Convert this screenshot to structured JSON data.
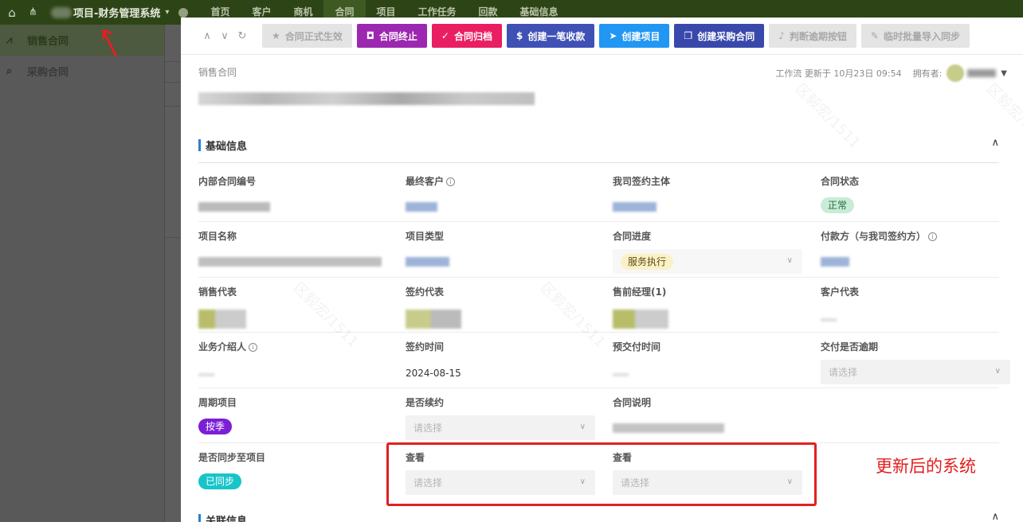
{
  "topnav": {
    "app_name": "项目-财务管理系统",
    "menu": [
      "首页",
      "客户",
      "商机",
      "合同",
      "项目",
      "工作任务",
      "回款",
      "基础信息"
    ],
    "active_menu": "合同"
  },
  "sidebar": {
    "items": [
      {
        "label": "销售合同",
        "active": true
      },
      {
        "label": "采购合同",
        "active": false
      }
    ]
  },
  "toolbar": {
    "buttons": [
      {
        "label": "合同正式生效",
        "style": "gray",
        "icon": "star-icon"
      },
      {
        "label": "合同终止",
        "style": "purple",
        "icon": "stop-icon"
      },
      {
        "label": "合同归档",
        "style": "pink",
        "icon": "check-icon"
      },
      {
        "label": "创建一笔收款",
        "style": "indigo",
        "icon": "dollar-icon"
      },
      {
        "label": "创建项目",
        "style": "blue",
        "icon": "send-icon"
      },
      {
        "label": "创建采购合同",
        "style": "indigo2",
        "icon": "copy-icon"
      },
      {
        "label": "判断逾期按钮",
        "style": "gray",
        "icon": "bell-icon"
      },
      {
        "label": "临时批量导入同步",
        "style": "gray",
        "icon": "wrench-icon"
      }
    ]
  },
  "record": {
    "breadcrumb": "销售合同",
    "workflow_text": "工作流 更新于 10月23日 09:54",
    "owner_label": "拥有者:"
  },
  "section_basic": {
    "title": "基础信息"
  },
  "fields": {
    "internal_no": {
      "label": "内部合同编号"
    },
    "final_customer": {
      "label": "最终客户"
    },
    "our_entity": {
      "label": "我司签约主体"
    },
    "contract_status": {
      "label": "合同状态",
      "value": "正常"
    },
    "project_name": {
      "label": "项目名称"
    },
    "project_type": {
      "label": "项目类型"
    },
    "contract_progress": {
      "label": "合同进度",
      "value": "服务执行"
    },
    "payer": {
      "label": "付款方（与我司签约方）"
    },
    "sales_rep": {
      "label": "销售代表"
    },
    "signing_rep": {
      "label": "签约代表"
    },
    "presales_mgr": {
      "label": "售前经理(1)"
    },
    "customer_rep": {
      "label": "客户代表"
    },
    "referrer": {
      "label": "业务介绍人"
    },
    "sign_date": {
      "label": "签约时间",
      "value": "2024-08-15"
    },
    "expected_delivery": {
      "label": "预交付时间"
    },
    "delivery_overdue": {
      "label": "交付是否逾期",
      "placeholder": "请选择"
    },
    "periodic_project": {
      "label": "周期项目",
      "value": "按季"
    },
    "is_renewal": {
      "label": "是否续约",
      "placeholder": "请选择"
    },
    "contract_desc": {
      "label": "合同说明"
    },
    "synced_to_project": {
      "label": "是否同步至项目",
      "value": "已同步"
    },
    "view1": {
      "label": "查看",
      "placeholder": "请选择"
    },
    "view2": {
      "label": "查看",
      "placeholder": "请选择"
    }
  },
  "annotation": "更新后的系统",
  "section_related": {
    "title": "关联信息"
  },
  "watermark": "区毅宏/1511"
}
